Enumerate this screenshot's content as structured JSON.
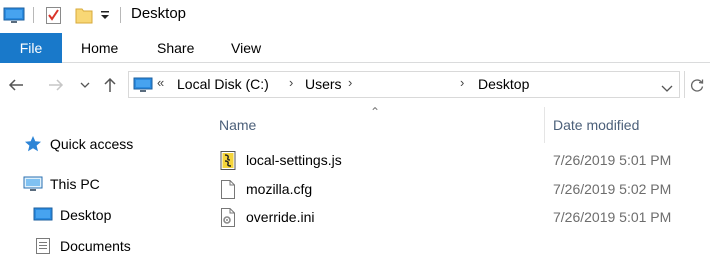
{
  "window": {
    "title": "Desktop"
  },
  "ribbon": {
    "tabs": {
      "file": "File",
      "home": "Home",
      "share": "Share",
      "view": "View"
    }
  },
  "address": {
    "overflow": "«",
    "segments": [
      "Local Disk (C:)",
      "Users",
      "Desktop"
    ]
  },
  "nav_pane": {
    "quick_access": "Quick access",
    "this_pc": "This PC",
    "desktop": "Desktop",
    "documents": "Documents"
  },
  "file_list": {
    "columns": {
      "name": "Name",
      "date_modified": "Date modified"
    },
    "files": [
      {
        "name": "local-settings.js",
        "date": "7/26/2019 5:01 PM",
        "icon": "script-file-icon"
      },
      {
        "name": "mozilla.cfg",
        "date": "7/26/2019 5:02 PM",
        "icon": "blank-file-icon"
      },
      {
        "name": "override.ini",
        "date": "7/26/2019 5:01 PM",
        "icon": "settings-file-icon"
      }
    ]
  },
  "colors": {
    "accent": "#1979ca",
    "header_text": "#4c607a",
    "date_text": "#6d6d6d"
  }
}
